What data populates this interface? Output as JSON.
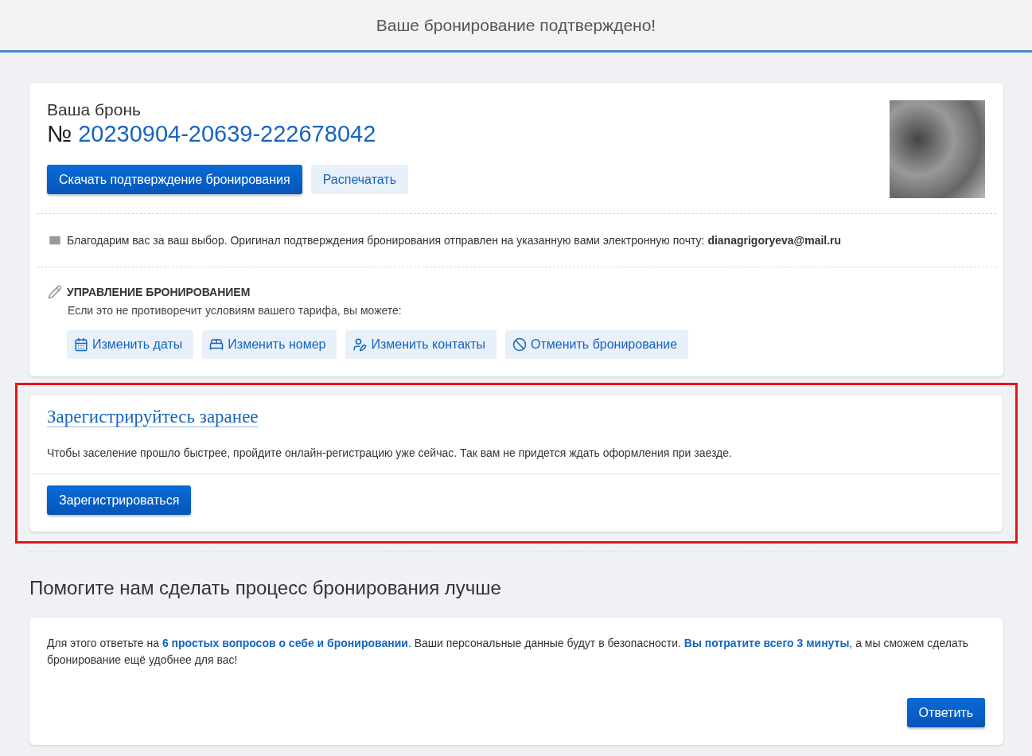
{
  "header": {
    "title": "Ваше бронирование подтверждено!"
  },
  "booking": {
    "label": "Ваша бронь",
    "number_prefix": "№",
    "number": "20230904-20639-222678042",
    "buttons": [
      {
        "label": "Скачать подтверждение бронирования",
        "kind": "primary"
      },
      {
        "label": "Распечатать",
        "kind": "secondary"
      }
    ],
    "email_note": "Благодарим вас за ваш выбор. Оригинал подтверждения бронирования отправлен на указанную вами электронную почту: **dianagrigoryeva@mail.ru**",
    "manage": {
      "title": "УПРАВЛЕНИЕ БРОНИРОВАНИЕМ",
      "subtitle": "Если это не противоречит условиям вашего тарифа, вы можете:",
      "actions": [
        {
          "label": "Изменить даты",
          "kind": "dates"
        },
        {
          "label": "Изменить номер",
          "kind": "room"
        },
        {
          "label": "Изменить контакты",
          "kind": "contacts"
        },
        {
          "label": "Отменить бронирование",
          "kind": "cancel"
        }
      ]
    }
  },
  "registration": {
    "highlighted": true,
    "title": "Зарегистрируйтесь заранее",
    "text": "Чтобы заселение прошло быстрее, пройдите онлайн-регистрацию уже сейчас. Так вам не придется ждать оформления при заезде.",
    "button": "Зарегистрироваться"
  },
  "survey": {
    "heading": "Помогите нам сделать процесс бронирования лучше",
    "text": "Для этого ответьте на **6 простых вопросов о себе и бронировании**. Ваши персональные данные будут в безопасности. **Вы потратите всего 3 минуты**, а мы сможем сделать бронирование ещё удобнее для вас!",
    "button": "Ответить"
  }
}
